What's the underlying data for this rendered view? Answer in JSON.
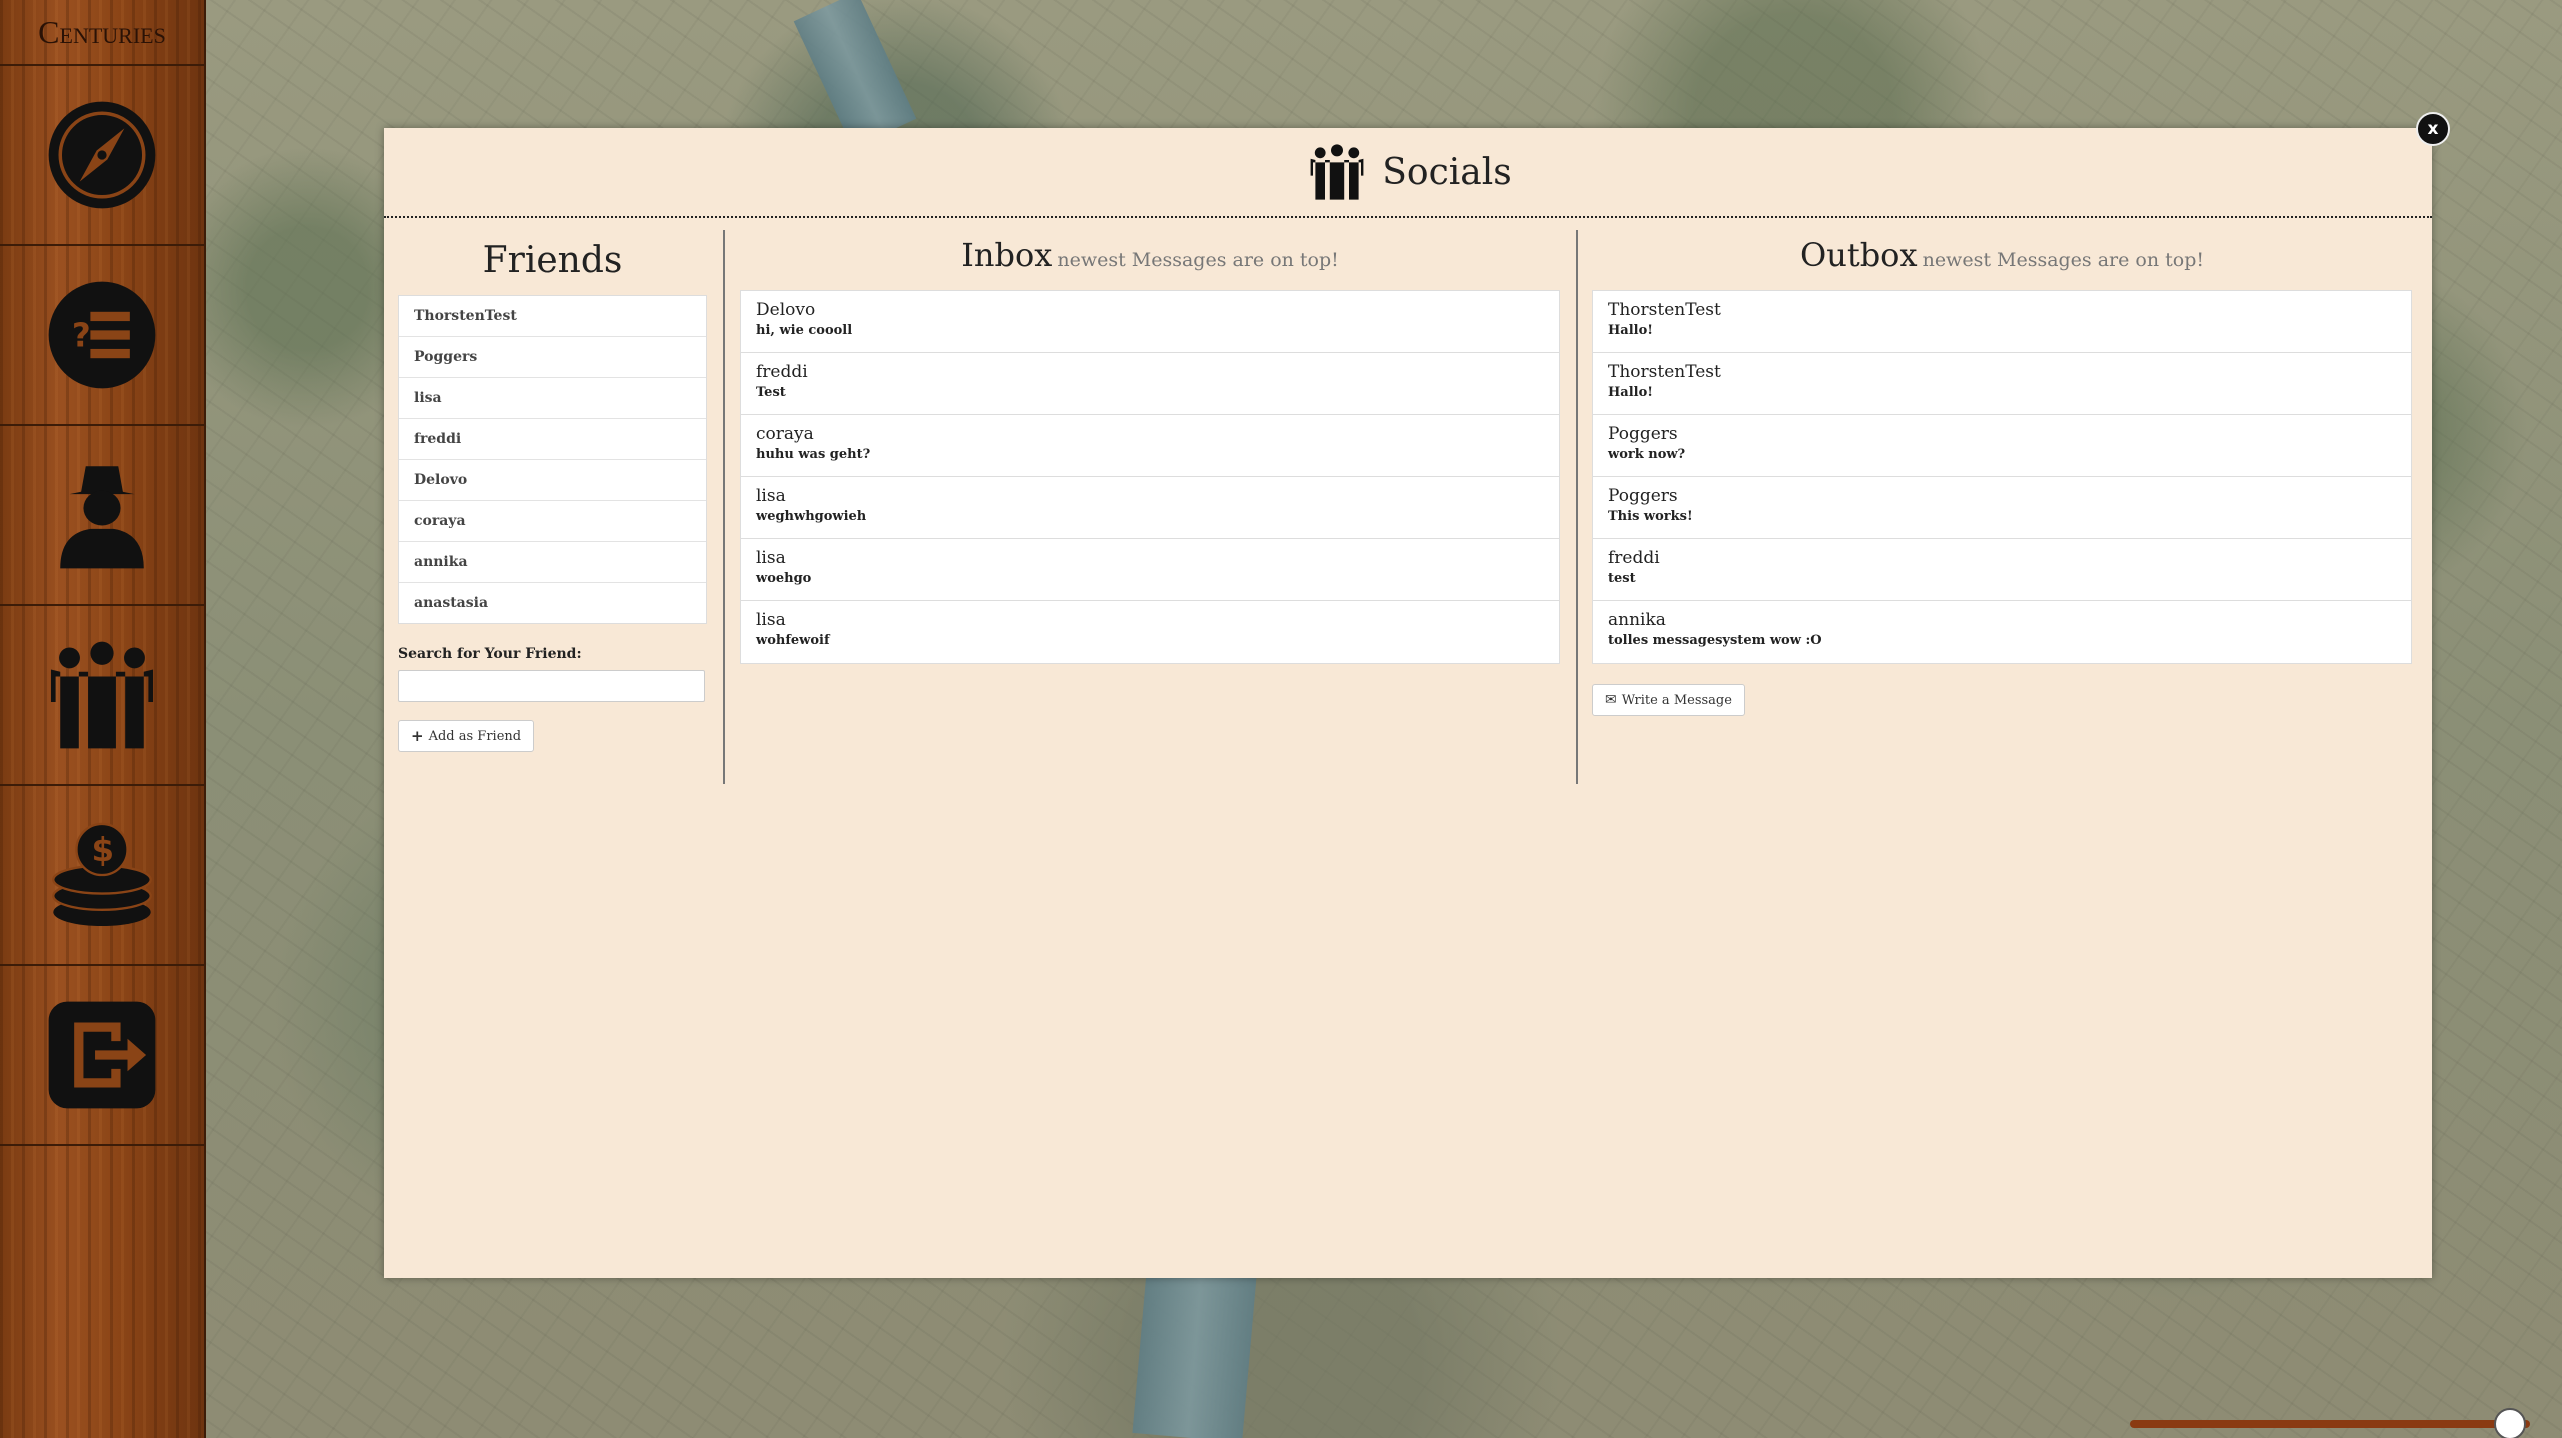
{
  "app": {
    "logo": "Centuries"
  },
  "sidebar": {
    "items": [
      {
        "icon": "compass-icon",
        "label": ""
      },
      {
        "icon": "quest-list-icon",
        "label": ""
      },
      {
        "icon": "profile-icon",
        "label": ""
      },
      {
        "icon": "socials-icon",
        "label": ""
      },
      {
        "icon": "coins-icon",
        "label": ""
      },
      {
        "icon": "logout-icon",
        "label": ""
      }
    ]
  },
  "modal": {
    "title": "Socials",
    "close_label": "x"
  },
  "friends": {
    "title": "Friends",
    "list": [
      "ThorstenTest",
      "Poggers",
      "lisa",
      "freddi",
      "Delovo",
      "coraya",
      "annika",
      "anastasia"
    ],
    "search_label": "Search for Your Friend:",
    "search_value": "",
    "add_label": "Add as Friend"
  },
  "inbox": {
    "title": "Inbox",
    "subtitle": "newest Messages are on top!",
    "messages": [
      {
        "sender": "Delovo",
        "text": "hi, wie coooll"
      },
      {
        "sender": "freddi",
        "text": "Test"
      },
      {
        "sender": "coraya",
        "text": "huhu was geht?"
      },
      {
        "sender": "lisa",
        "text": "weghwhgowieh"
      },
      {
        "sender": "lisa",
        "text": "woehgo"
      },
      {
        "sender": "lisa",
        "text": "wohfewoif"
      }
    ]
  },
  "outbox": {
    "title": "Outbox",
    "subtitle": "newest Messages are on top!",
    "messages": [
      {
        "sender": "ThorstenTest",
        "text": "Hallo!"
      },
      {
        "sender": "ThorstenTest",
        "text": "Hallo!"
      },
      {
        "sender": "Poggers",
        "text": "work now?"
      },
      {
        "sender": "Poggers",
        "text": "This works!"
      },
      {
        "sender": "freddi",
        "text": "test"
      },
      {
        "sender": "annika",
        "text": "tolles messagesystem wow :O"
      }
    ],
    "write_label": "Write a Message"
  },
  "colors": {
    "modal_bg": "#f8e8d6",
    "sidebar_wood": "#8a4416",
    "icon_dark": "#111111"
  }
}
